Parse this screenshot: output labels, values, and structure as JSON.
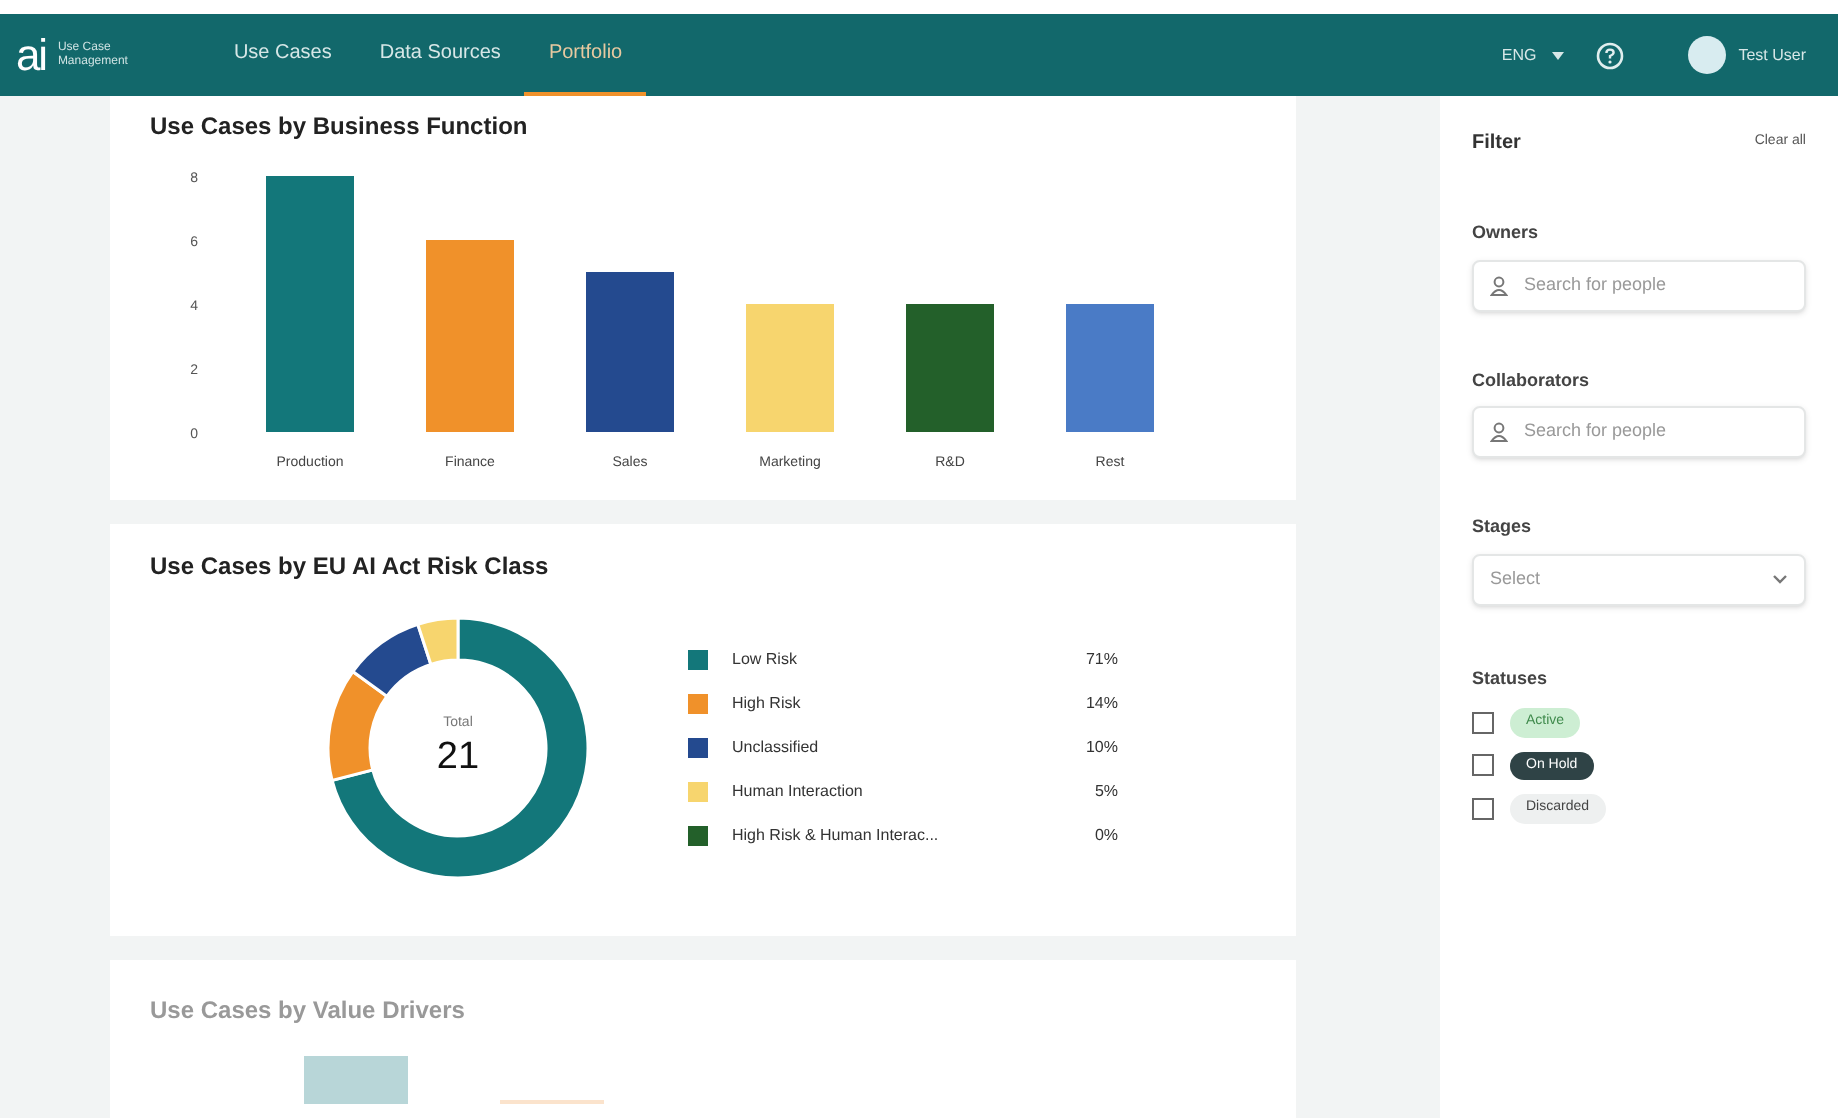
{
  "header": {
    "logo": "ai",
    "product": "Use Case Management",
    "nav": [
      {
        "label": "Use Cases",
        "selected": false
      },
      {
        "label": "Data Sources",
        "selected": false
      },
      {
        "label": "Portfolio",
        "selected": true
      }
    ],
    "language": "ENG",
    "user": "Test User"
  },
  "business_function": {
    "title": "Use Cases by Business Function",
    "chart_data": {
      "type": "bar",
      "categories": [
        "Production",
        "Finance",
        "Sales",
        "Marketing",
        "R&D",
        "Rest"
      ],
      "values": [
        8,
        6,
        5,
        4,
        4,
        4
      ],
      "colors": [
        "#13777a",
        "#f0912a",
        "#244a8f",
        "#f7d56e",
        "#23602a",
        "#4a7bc6"
      ],
      "yticks": [
        0,
        2,
        4,
        6,
        8
      ],
      "ylim": [
        0,
        8
      ]
    }
  },
  "risk_class": {
    "title": "Use Cases by EU AI Act Risk Class",
    "total_label": "Total",
    "total": "21",
    "chart_data": {
      "type": "donut",
      "categories": [
        "Low Risk",
        "High Risk",
        "Unclassified",
        "Human Interaction",
        "High Risk & Human Interac..."
      ],
      "values": [
        71,
        14,
        10,
        5,
        0
      ],
      "colors": [
        "#13777a",
        "#f0912a",
        "#244a8f",
        "#f7d56e",
        "#23602a"
      ]
    },
    "percents": [
      "71%",
      "14%",
      "10%",
      "5%",
      "0%"
    ]
  },
  "value_drivers": {
    "title": "Use Cases by Value Drivers"
  },
  "filter": {
    "title": "Filter",
    "clear": "Clear all",
    "owners": {
      "label": "Owners",
      "placeholder": "Search for people"
    },
    "collaborators": {
      "label": "Collaborators",
      "placeholder": "Search for people"
    },
    "stages": {
      "label": "Stages",
      "placeholder": "Select"
    },
    "statuses_label": "Statuses",
    "statuses": [
      {
        "label": "Active",
        "kind": "active",
        "checked": false
      },
      {
        "label": "On Hold",
        "kind": "hold",
        "checked": false
      },
      {
        "label": "Discarded",
        "kind": "discarded",
        "checked": false
      }
    ]
  }
}
